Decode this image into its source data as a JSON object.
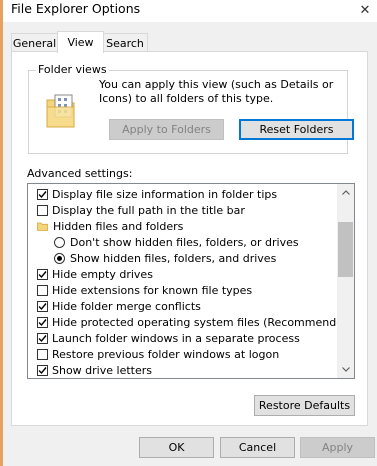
{
  "window": {
    "title": "File Explorer Options",
    "close_glyph": "✕"
  },
  "tabs": [
    {
      "label": "General",
      "active": false
    },
    {
      "label": "View",
      "active": true
    },
    {
      "label": "Search",
      "active": false
    }
  ],
  "folder_views": {
    "title": "Folder views",
    "description": "You can apply this view (such as Details or Icons) to all folders of this type.",
    "apply_label": "Apply to Folders",
    "reset_label": "Reset Folders"
  },
  "advanced": {
    "label": "Advanced settings:",
    "items": [
      {
        "type": "checkbox",
        "label": "Display file size information in folder tips",
        "checked": true,
        "indent": 0
      },
      {
        "type": "checkbox",
        "label": "Display the full path in the title bar",
        "checked": false,
        "indent": 0
      },
      {
        "type": "folder",
        "label": "Hidden files and folders",
        "indent": 0
      },
      {
        "type": "radio",
        "label": "Don't show hidden files, folders, or drives",
        "checked": false,
        "indent": 1
      },
      {
        "type": "radio",
        "label": "Show hidden files, folders, and drives",
        "checked": true,
        "indent": 1
      },
      {
        "type": "checkbox",
        "label": "Hide empty drives",
        "checked": true,
        "indent": 0
      },
      {
        "type": "checkbox",
        "label": "Hide extensions for known file types",
        "checked": false,
        "indent": 0
      },
      {
        "type": "checkbox",
        "label": "Hide folder merge conflicts",
        "checked": true,
        "indent": 0
      },
      {
        "type": "checkbox",
        "label": "Hide protected operating system files (Recommended)",
        "checked": true,
        "indent": 0
      },
      {
        "type": "checkbox",
        "label": "Launch folder windows in a separate process",
        "checked": true,
        "indent": 0
      },
      {
        "type": "checkbox",
        "label": "Restore previous folder windows at logon",
        "checked": false,
        "indent": 0
      },
      {
        "type": "checkbox",
        "label": "Show drive letters",
        "checked": true,
        "indent": 0
      }
    ],
    "restore_label": "Restore Defaults"
  },
  "footer": {
    "ok_label": "OK",
    "cancel_label": "Cancel",
    "apply_label": "Apply"
  },
  "colors": {
    "accent": "#0078d7",
    "window_border": "#e8a15f",
    "disabled_text": "#838383"
  }
}
